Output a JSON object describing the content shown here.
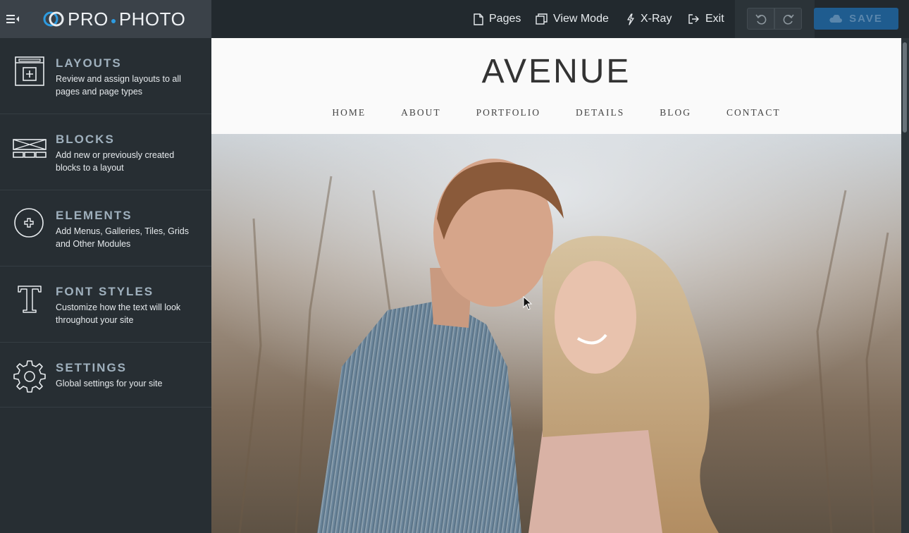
{
  "brand": {
    "name_left": "PRO",
    "name_right": "PHOTO"
  },
  "toolbar": {
    "pages_label": "Pages",
    "view_mode_label": "View Mode",
    "xray_label": "X-Ray",
    "exit_label": "Exit",
    "save_label": "SAVE"
  },
  "sidebar": {
    "items": [
      {
        "title": "LAYOUTS",
        "description": "Review and assign layouts to all pages and page types",
        "icon": "layout-add-icon"
      },
      {
        "title": "BLOCKS",
        "description": "Add new or previously created blocks to a layout",
        "icon": "blocks-icon"
      },
      {
        "title": "ELEMENTS",
        "description": "Add Menus, Galleries, Tiles, Grids and Other Modules",
        "icon": "plus-circle-icon"
      },
      {
        "title": "FONT STYLES",
        "description": "Customize how the text will look throughout your site",
        "icon": "serif-t-icon"
      },
      {
        "title": "SETTINGS",
        "description": "Global settings for your site",
        "icon": "gear-icon"
      }
    ]
  },
  "site": {
    "title": "AVENUE",
    "nav": [
      "HOME",
      "ABOUT",
      "PORTFOLIO",
      "DETAILS",
      "BLOG",
      "CONTACT"
    ]
  },
  "colors": {
    "topbar": "#22292e",
    "brand_panel": "#3b4249",
    "sidebar": "#272e33",
    "accent_blue": "#2d9be0",
    "save_button": "#1f5c8f"
  }
}
